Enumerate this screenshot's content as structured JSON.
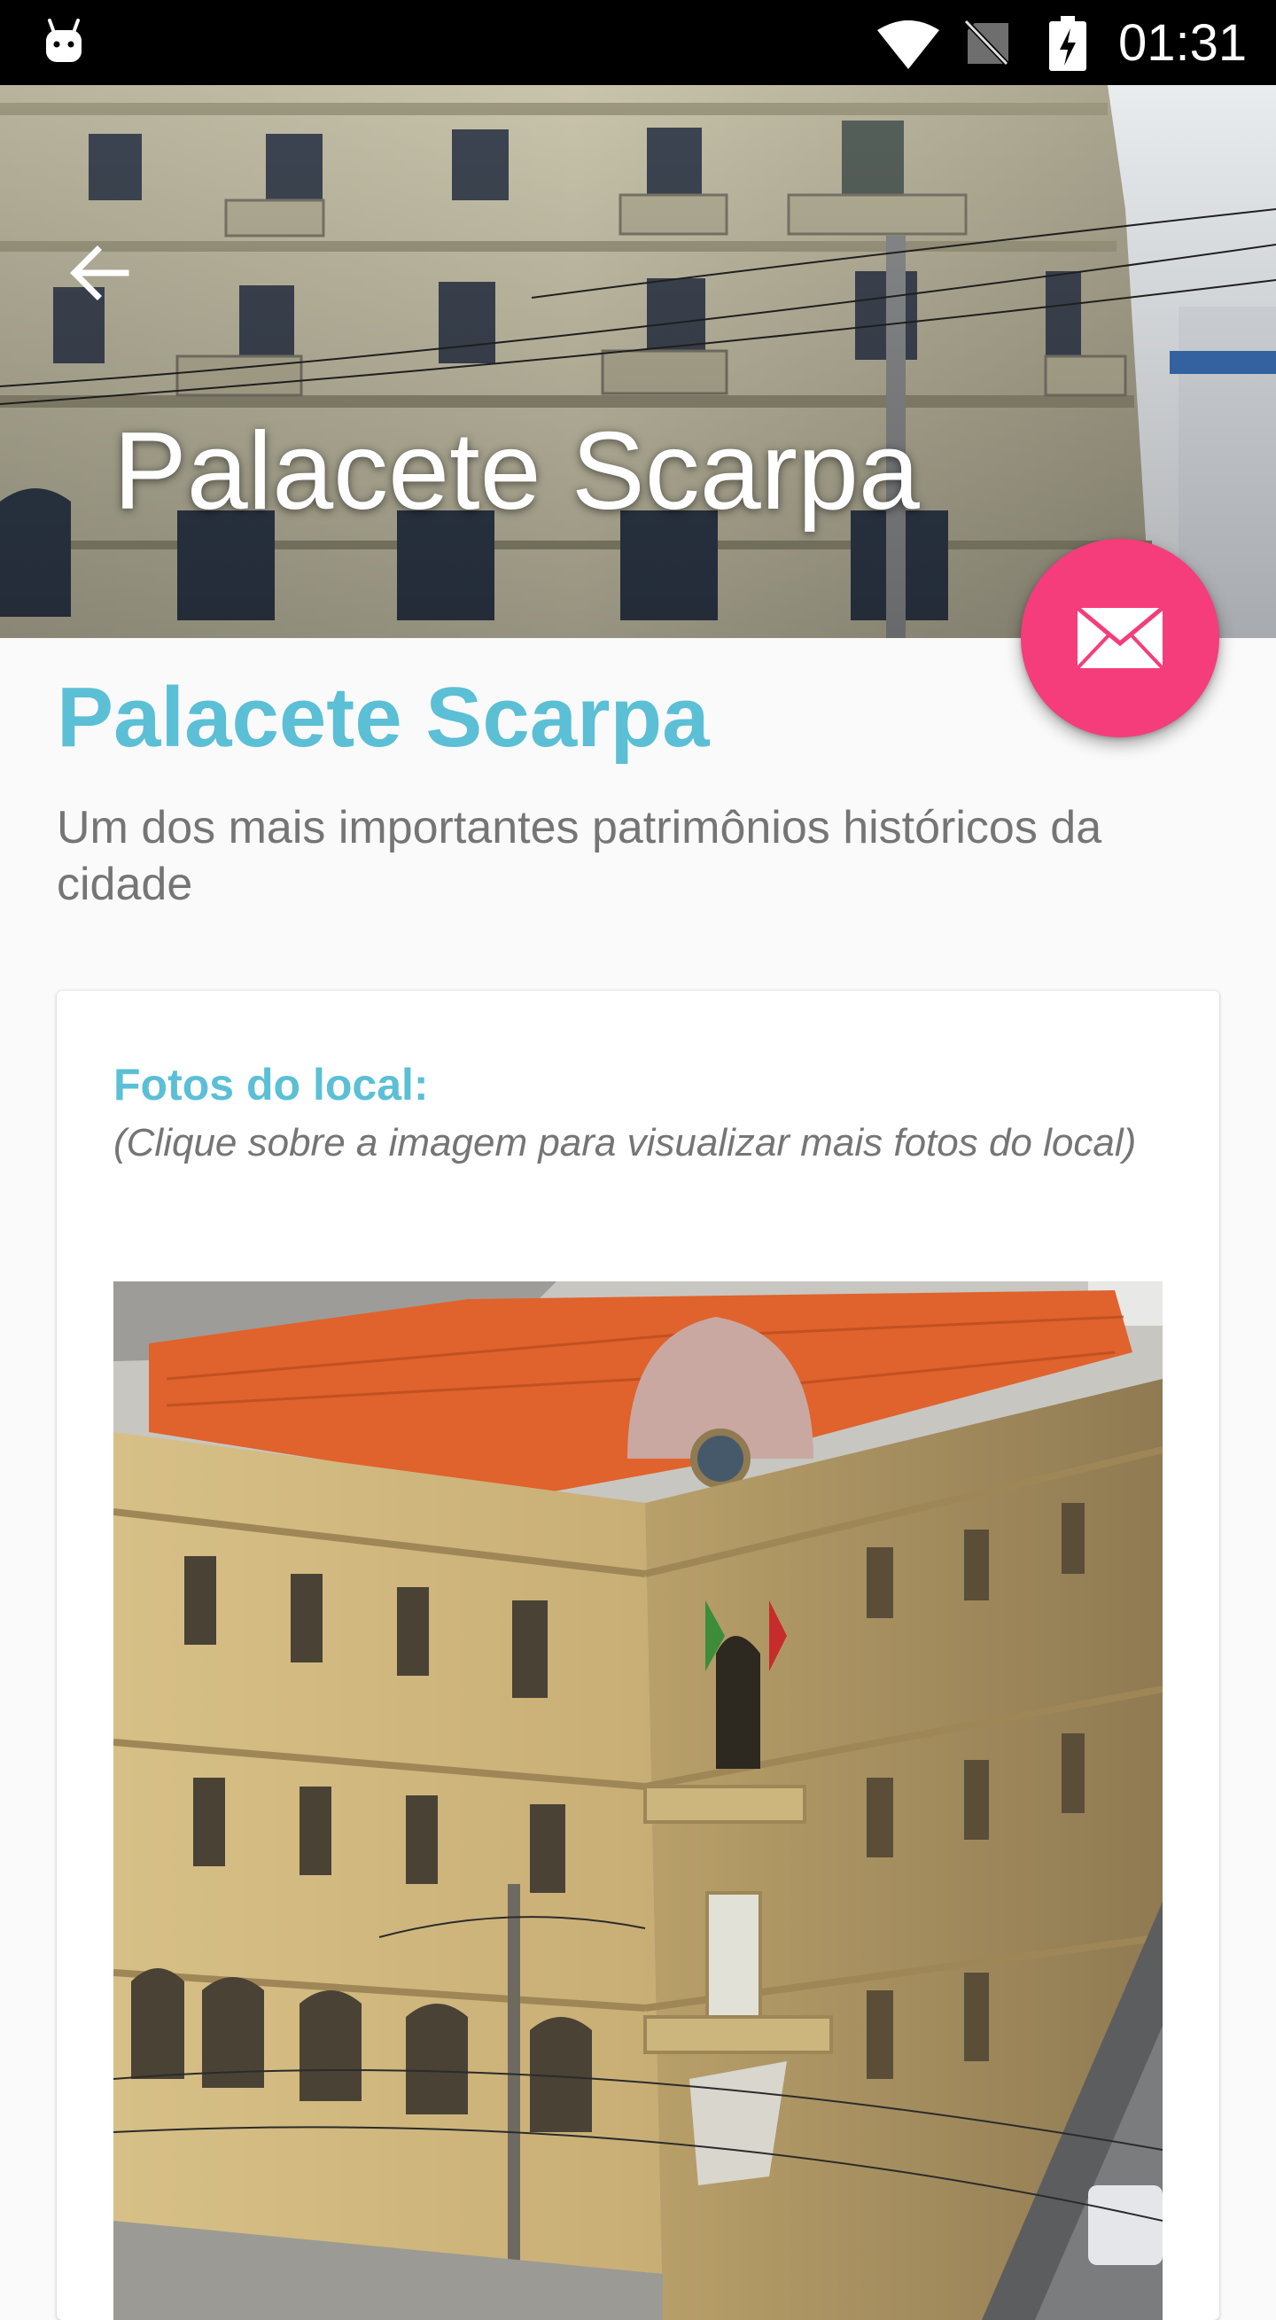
{
  "status_bar": {
    "time": "01:31",
    "icons": [
      "android-icon",
      "wifi-icon",
      "no-signal-icon",
      "battery-charging-icon"
    ]
  },
  "header": {
    "title": "Palacete Scarpa",
    "back_icon": "arrow-back-icon",
    "image": "building-facade-photo"
  },
  "fab": {
    "icon": "envelope-icon",
    "color": "#f53d7b"
  },
  "content": {
    "title": "Palacete Scarpa",
    "subtitle": "Um dos mais importantes patrimônios históricos da cidade"
  },
  "photos_card": {
    "title": "Fotos do local:",
    "hint": "(Clique sobre a imagem para visualizar mais fotos do local)",
    "image": "palace-aerial-photo"
  },
  "colors": {
    "accent": "#5bbfd6",
    "fab": "#f53d7b",
    "status_bar": "#000000",
    "text_secondary": "#757575"
  }
}
